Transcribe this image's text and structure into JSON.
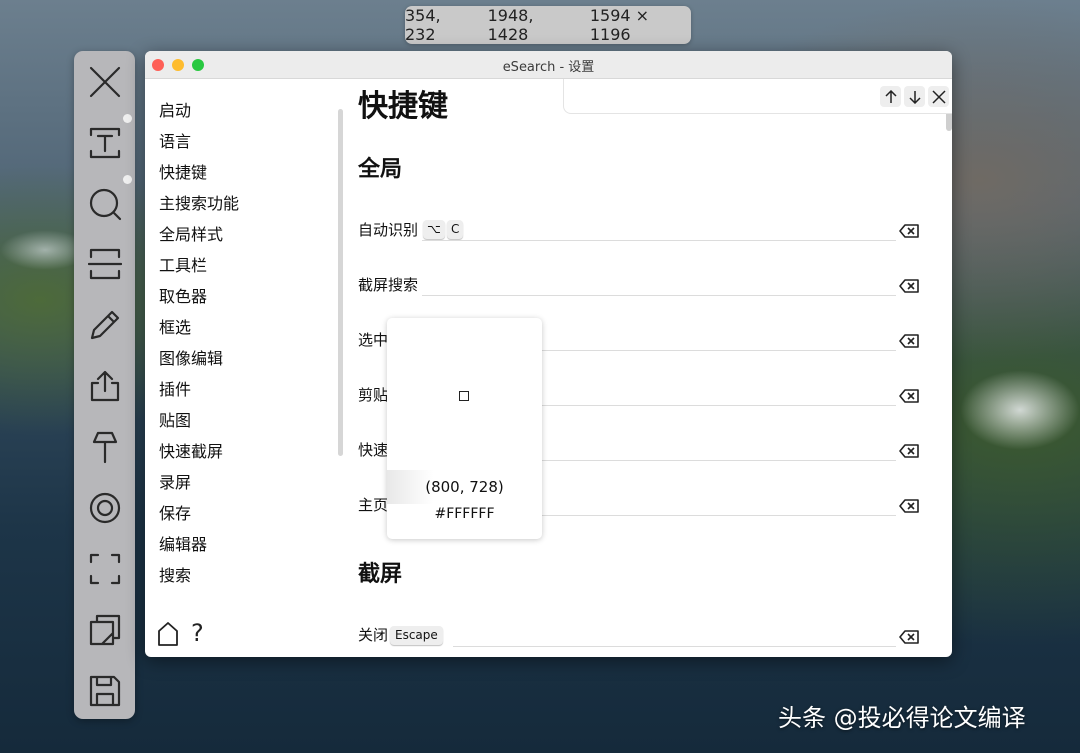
{
  "capture": {
    "position": "354, 232",
    "end": "1948, 1428",
    "size": "1594 × 1196"
  },
  "toolbar": {
    "tools": [
      "close-icon",
      "text-ocr-icon",
      "search-icon",
      "scroll-capture-icon",
      "pencil-icon",
      "share-icon",
      "pin-icon",
      "record-icon",
      "selection-icon",
      "copy-icon",
      "save-icon"
    ]
  },
  "window": {
    "title": "eSearch - 设置",
    "nav": [
      "启动",
      "语言",
      "快捷键",
      "主搜索功能",
      "全局样式",
      "工具栏",
      "取色器",
      "框选",
      "图像编辑",
      "插件",
      "贴图",
      "快速截屏",
      "录屏",
      "保存",
      "编辑器",
      "搜索"
    ],
    "content": {
      "heading": "快捷键",
      "section_global": "全局",
      "rows": [
        {
          "label": "自动识别",
          "keys": [
            "⌥",
            "C"
          ]
        },
        {
          "label": "截屏搜索",
          "keys": []
        },
        {
          "label": "选中",
          "keys": []
        },
        {
          "label": "剪贴",
          "keys": []
        },
        {
          "label": "快速",
          "keys": []
        },
        {
          "label": "主页",
          "keys": []
        }
      ],
      "section_capture": "截屏",
      "close_row": {
        "label": "关闭",
        "key": "Escape"
      }
    }
  },
  "picker": {
    "coord": "(800, 728)",
    "color": "#FFFFFF"
  },
  "watermark": "头条 @投必得论文编译"
}
